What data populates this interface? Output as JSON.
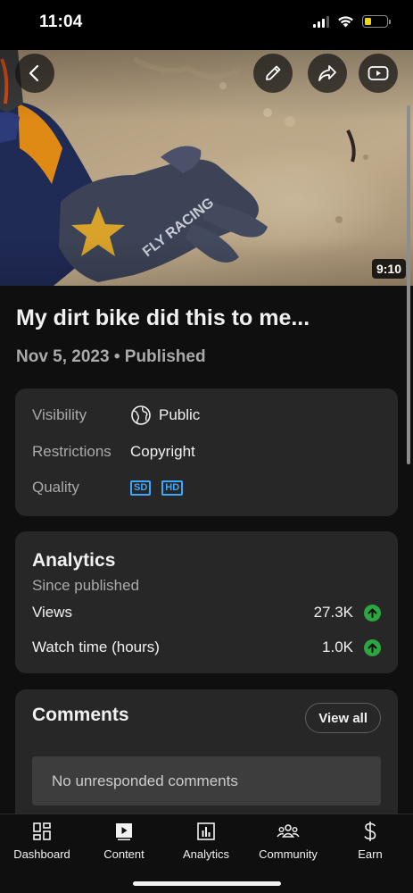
{
  "status_bar": {
    "time": "11:04",
    "battery_color": "#f5d30f"
  },
  "video": {
    "duration": "9:10",
    "title": "My dirt bike did this to me...",
    "meta": "Nov 5, 2023 • Published",
    "overlay_icons": [
      "back-arrow-icon",
      "edit-pencil-icon",
      "share-icon",
      "youtube-play-icon"
    ]
  },
  "details": {
    "visibility_label": "Visibility",
    "visibility_value": "Public",
    "restrictions_label": "Restrictions",
    "restrictions_value": "Copyright",
    "quality_label": "Quality",
    "quality_badges": [
      "SD",
      "HD"
    ],
    "badge_color": "#3ea6ff"
  },
  "analytics": {
    "heading": "Analytics",
    "subheading": "Since published",
    "metrics": [
      {
        "label": "Views",
        "value": "27.3K",
        "trend": "up"
      },
      {
        "label": "Watch time (hours)",
        "value": "1.0K",
        "trend": "up"
      }
    ],
    "trend_color": "#2ba640"
  },
  "comments": {
    "heading": "Comments",
    "view_all_label": "View all",
    "empty_message": "No unresponded comments"
  },
  "bottom_nav": {
    "items": [
      {
        "label": "Dashboard",
        "icon": "dashboard-icon"
      },
      {
        "label": "Content",
        "icon": "content-icon"
      },
      {
        "label": "Analytics",
        "icon": "analytics-icon"
      },
      {
        "label": "Community",
        "icon": "community-icon"
      },
      {
        "label": "Earn",
        "icon": "dollar-icon"
      }
    ]
  }
}
